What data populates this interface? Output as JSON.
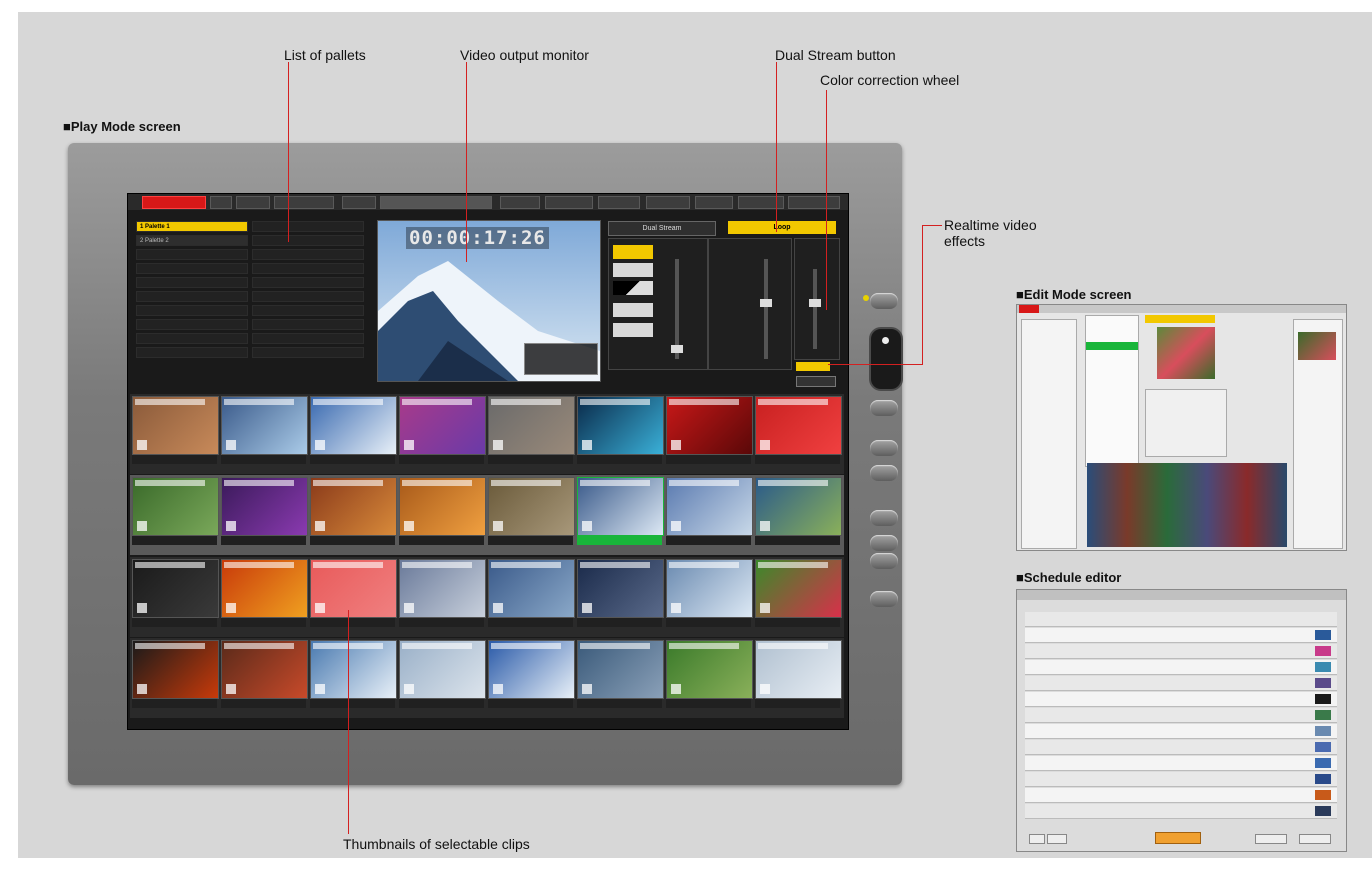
{
  "headings": {
    "play_mode": "■Play Mode screen",
    "edit_mode": "■Edit Mode screen",
    "schedule": "■Schedule editor"
  },
  "callouts": {
    "list_of_pallets": "List of pallets",
    "video_output_monitor": "Video output monitor",
    "dual_stream_button": "Dual Stream button",
    "color_correction_wheel": "Color correction wheel",
    "realtime_video_effects_line1": "Realtime video",
    "realtime_video_effects_line2": "effects",
    "thumbnails": "Thumbnails of selectable clips"
  },
  "player": {
    "timecode": "00:00:17:26",
    "dual_stream_label": "Dual Stream",
    "loop_label": "Loop",
    "pallets": [
      "1 Palette 1",
      "2 Palette 2"
    ],
    "transport": [
      "|◀",
      "◀◀",
      "◀",
      "■",
      "▶",
      "▶",
      "▶▶",
      "▶|"
    ]
  },
  "colors": {
    "accent_yellow": "#f2c800",
    "accent_red": "#d81818",
    "accent_green": "#19b53a",
    "callout_line": "#d32020"
  }
}
